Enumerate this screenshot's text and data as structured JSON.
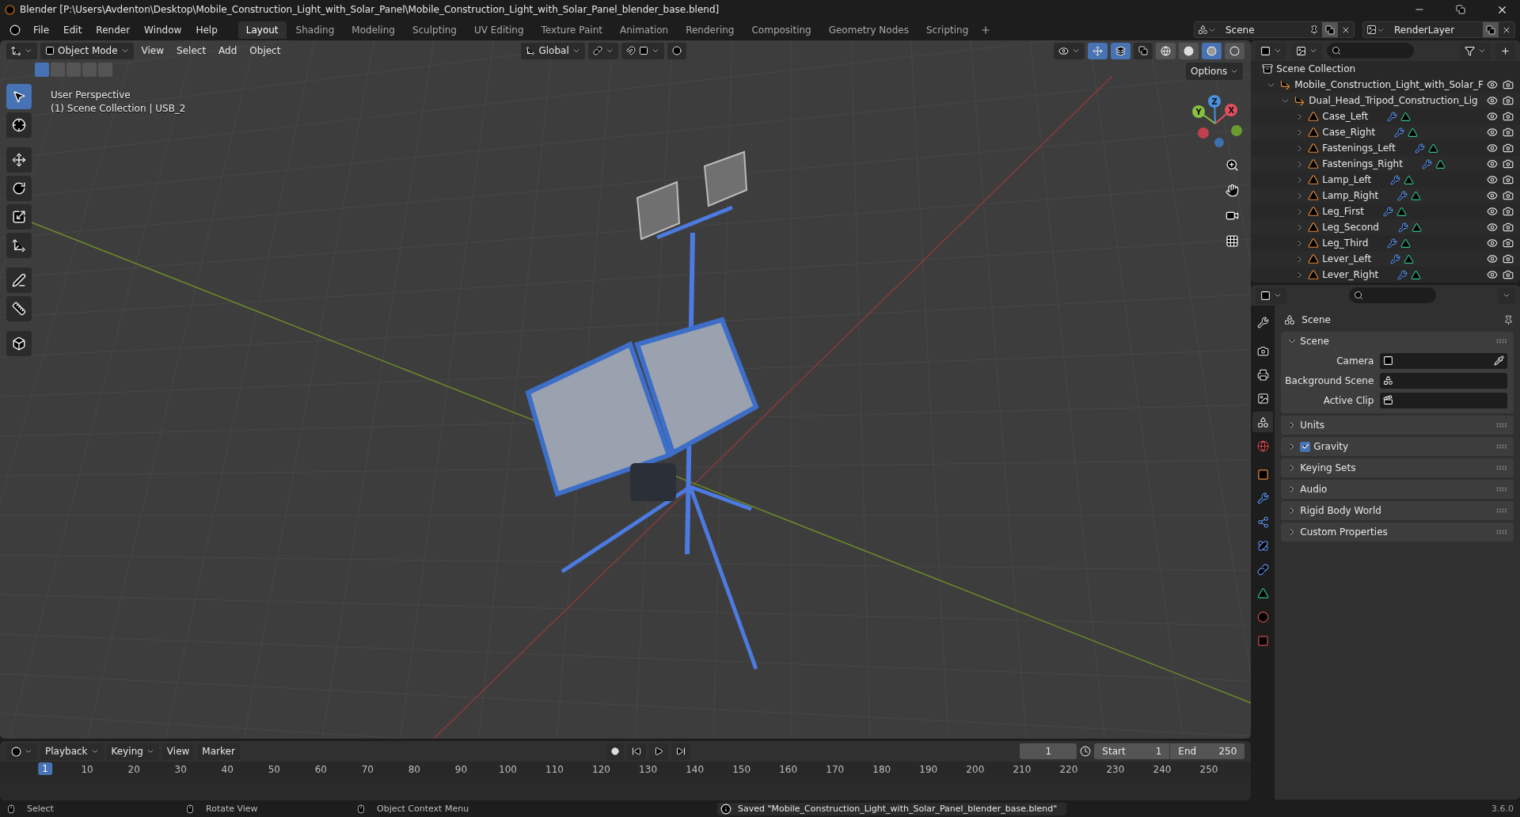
{
  "window": {
    "title": "Blender [P:\\Users\\Avdenton\\Desktop\\Mobile_Construction_Light_with_Solar_Panel\\Mobile_Construction_Light_with_Solar_Panel_blender_base.blend]"
  },
  "menu": [
    "File",
    "Edit",
    "Render",
    "Window",
    "Help"
  ],
  "workspaces": [
    {
      "label": "Layout",
      "selected": true
    },
    {
      "label": "Shading",
      "selected": false
    },
    {
      "label": "Modeling",
      "selected": false
    },
    {
      "label": "Sculpting",
      "selected": false
    },
    {
      "label": "UV Editing",
      "selected": false
    },
    {
      "label": "Texture Paint",
      "selected": false
    },
    {
      "label": "Animation",
      "selected": false
    },
    {
      "label": "Rendering",
      "selected": false
    },
    {
      "label": "Compositing",
      "selected": false
    },
    {
      "label": "Geometry Nodes",
      "selected": false
    },
    {
      "label": "Scripting",
      "selected": false
    }
  ],
  "scene_selector": {
    "value": "Scene"
  },
  "view_layer": {
    "value": "RenderLayer"
  },
  "viewport": {
    "mode": "Object Mode",
    "menu": [
      "View",
      "Select",
      "Add",
      "Object"
    ],
    "orientation": "Global",
    "options": "Options",
    "overlay_lines": [
      "User Perspective",
      "(1) Scene Collection | USB_2"
    ],
    "tools": [
      {
        "kind": "select",
        "selected": true
      },
      {
        "kind": "cursor",
        "selected": false
      },
      {
        "kind": "move",
        "selected": false
      },
      {
        "kind": "rotate",
        "selected": false
      },
      {
        "kind": "scale",
        "selected": false
      },
      {
        "kind": "transform",
        "selected": false
      },
      {
        "kind": "annotate",
        "selected": false
      },
      {
        "kind": "measure",
        "selected": false
      },
      {
        "kind": "add-cube",
        "selected": false
      }
    ],
    "shading": [
      {
        "kind": "wireframe",
        "selected": false
      },
      {
        "kind": "solid",
        "selected": false
      },
      {
        "kind": "material",
        "selected": true
      },
      {
        "kind": "rendered",
        "selected": false
      }
    ],
    "gizmo_axes": [
      "X",
      "Y",
      "Z"
    ]
  },
  "outliner": {
    "root": "Scene Collection",
    "tree": [
      {
        "name": "Mobile_Construction_Light_with_Solar_F",
        "kind": "empty",
        "expanded": true,
        "children": [
          {
            "name": "Dual_Head_Tripod_Construction_Lig",
            "kind": "empty",
            "expanded": true,
            "children": [
              {
                "name": "Case_Left",
                "kind": "mesh",
                "expanded": false
              },
              {
                "name": "Case_Right",
                "kind": "mesh",
                "expanded": false
              },
              {
                "name": "Fastenings_Left",
                "kind": "mesh",
                "expanded": false
              },
              {
                "name": "Fastenings_Right",
                "kind": "mesh",
                "expanded": false
              },
              {
                "name": "Lamp_Left",
                "kind": "mesh",
                "expanded": false
              },
              {
                "name": "Lamp_Right",
                "kind": "mesh",
                "expanded": false
              },
              {
                "name": "Leg_First",
                "kind": "mesh",
                "expanded": false
              },
              {
                "name": "Leg_Second",
                "kind": "mesh",
                "expanded": false
              },
              {
                "name": "Leg_Third",
                "kind": "mesh",
                "expanded": false
              },
              {
                "name": "Lever_Left",
                "kind": "mesh",
                "expanded": false
              },
              {
                "name": "Lever_Right",
                "kind": "mesh",
                "expanded": false
              }
            ]
          }
        ]
      }
    ]
  },
  "properties": {
    "context": "Scene",
    "tabs": [
      {
        "kind": "tool",
        "selected": false
      },
      {
        "kind": "render",
        "selected": false
      },
      {
        "kind": "output",
        "selected": false
      },
      {
        "kind": "view-layer",
        "selected": false
      },
      {
        "kind": "scene",
        "selected": true
      },
      {
        "kind": "world",
        "selected": false
      },
      {
        "kind": "object",
        "selected": false
      },
      {
        "kind": "modifiers",
        "selected": false
      },
      {
        "kind": "particles",
        "selected": false
      },
      {
        "kind": "physics",
        "selected": false
      },
      {
        "kind": "constraints",
        "selected": false
      },
      {
        "kind": "data",
        "selected": false
      },
      {
        "kind": "material",
        "selected": false
      },
      {
        "kind": "texture",
        "selected": false
      }
    ],
    "panels": [
      {
        "title": "Scene",
        "expanded": true,
        "fields": [
          {
            "label": "Camera",
            "kind": "camera"
          },
          {
            "label": "Background Scene",
            "kind": "scene"
          },
          {
            "label": "Active Clip",
            "kind": "clip"
          }
        ]
      },
      {
        "title": "Units",
        "expanded": false
      },
      {
        "title": "Gravity",
        "expanded": false,
        "checked": true
      },
      {
        "title": "Keying Sets",
        "expanded": false
      },
      {
        "title": "Audio",
        "expanded": false
      },
      {
        "title": "Rigid Body World",
        "expanded": false
      },
      {
        "title": "Custom Properties",
        "expanded": false
      }
    ]
  },
  "timeline": {
    "menu": [
      "Playback",
      "Keying",
      "View",
      "Marker"
    ],
    "current_frame": "1",
    "playhead_label": "1",
    "start_label": "Start",
    "start": "1",
    "end_label": "End",
    "end": "250",
    "ruler": [
      "10",
      "20",
      "30",
      "40",
      "50",
      "60",
      "70",
      "80",
      "90",
      "100",
      "110",
      "120",
      "130",
      "140",
      "150",
      "160",
      "170",
      "180",
      "190",
      "200",
      "210",
      "220",
      "230",
      "240",
      "250"
    ]
  },
  "status_bar": {
    "hints": [
      "Select",
      "Rotate View",
      "Object Context Menu"
    ],
    "message": "Saved \"Mobile_Construction_Light_with_Solar_Panel_blender_base.blend\"",
    "version": "3.6.0"
  }
}
